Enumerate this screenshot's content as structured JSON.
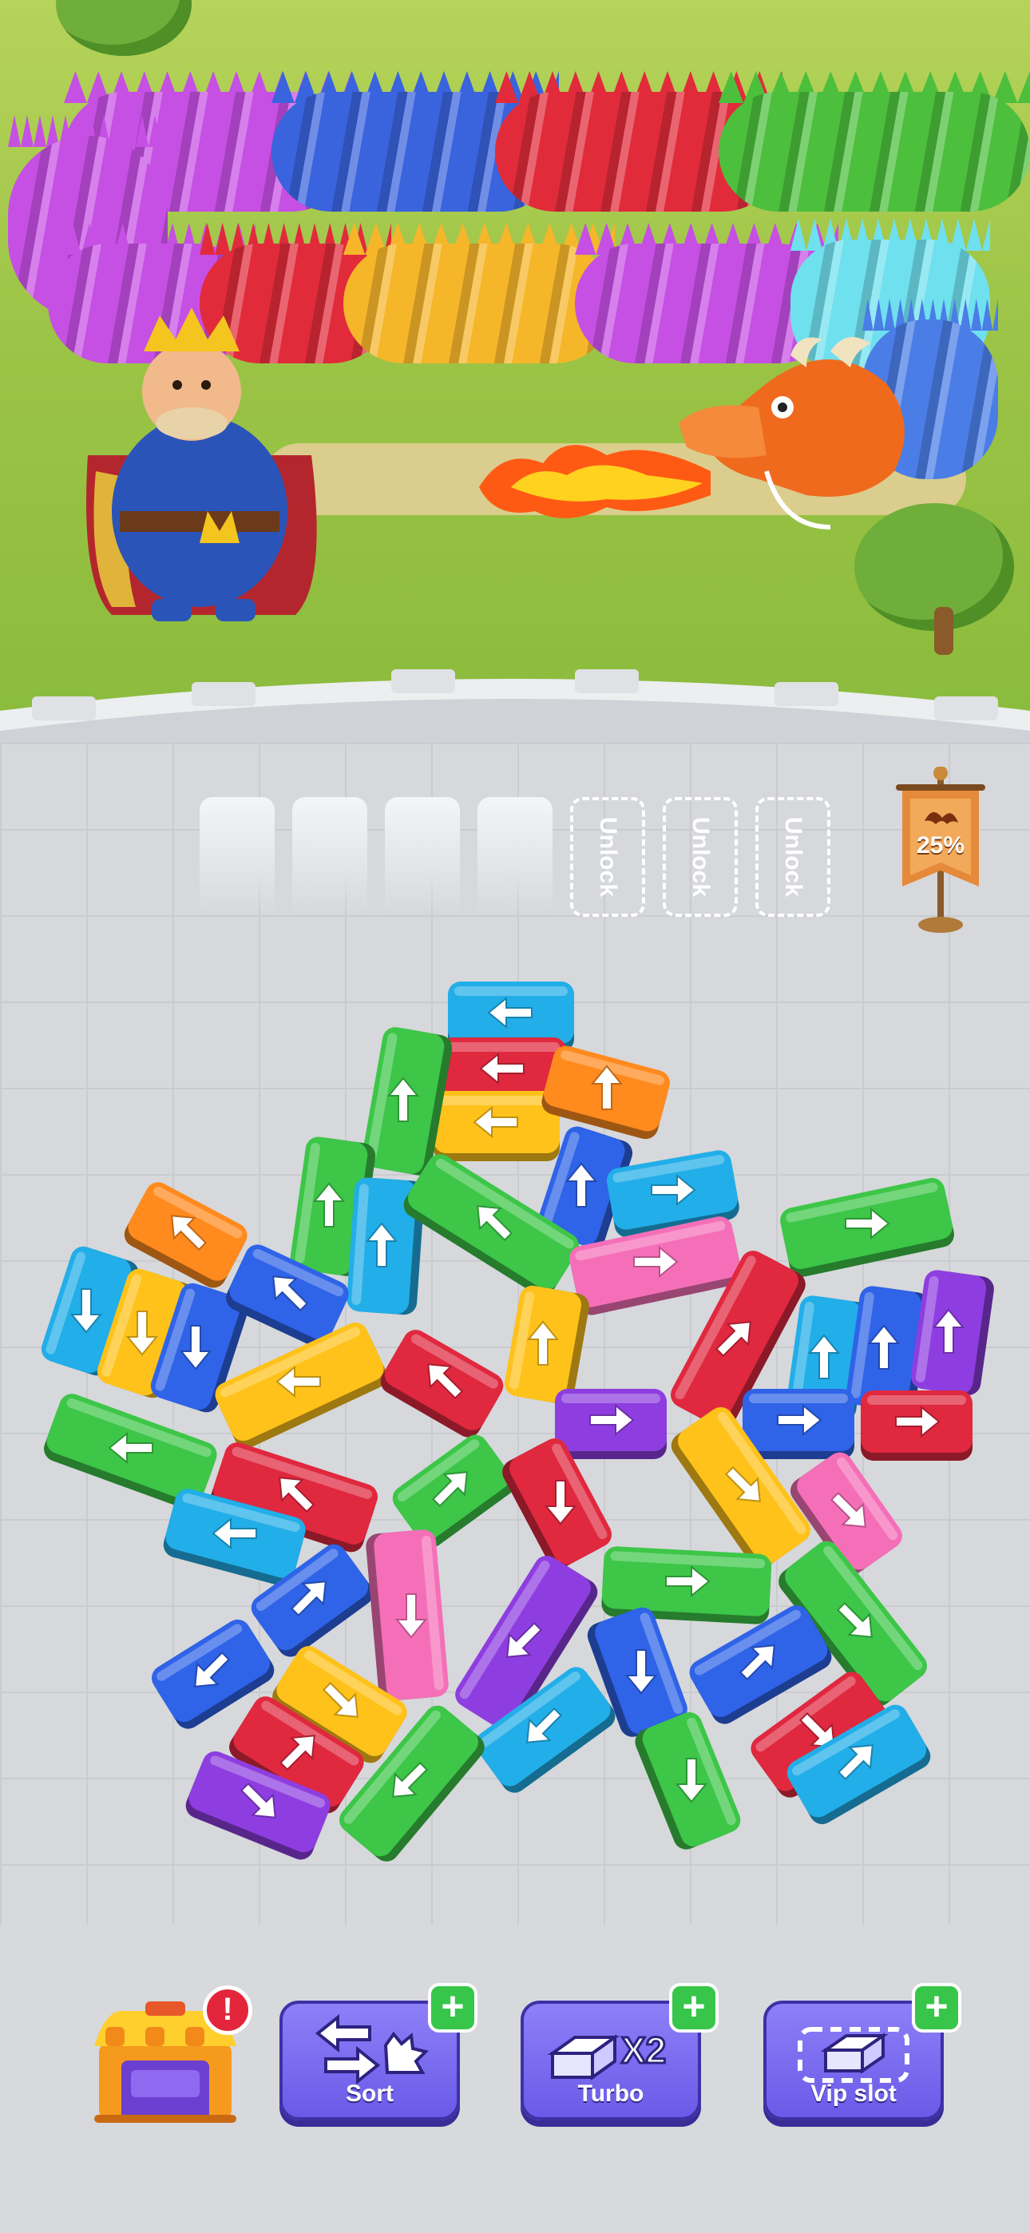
{
  "slots": {
    "open_count": 4,
    "locked": [
      {
        "label": "Unlock"
      },
      {
        "label": "Unlock"
      },
      {
        "label": "Unlock"
      }
    ]
  },
  "progress": {
    "percent_label": "25%",
    "value": 0.25
  },
  "toolbar": {
    "shop": {
      "icon": "shop-icon",
      "badge": "!"
    },
    "buttons": [
      {
        "label": "Sort",
        "icon": "sort-icon",
        "plus": "+"
      },
      {
        "label": "Turbo",
        "icon": "turbo-icon",
        "icon_text": "X2",
        "plus": "+"
      },
      {
        "label": "Vip slot",
        "icon": "vip-slot-icon",
        "plus": "+"
      }
    ]
  },
  "colors": {
    "red": "#e0283f",
    "green": "#3dc648",
    "blue": "#2f63e8",
    "cyan": "#22aee8",
    "yellow": "#ffc21a",
    "orange": "#ff8a1e",
    "pink": "#f56fb8",
    "purple": "#8e3ee0"
  },
  "blocks": [
    {
      "color": "cyan",
      "dir": "left"
    },
    {
      "color": "red",
      "dir": "left"
    },
    {
      "color": "yellow",
      "dir": "left"
    },
    {
      "color": "orange",
      "dir": "up"
    },
    {
      "color": "green",
      "dir": "up"
    },
    {
      "color": "green",
      "dir": "up"
    },
    {
      "color": "cyan",
      "dir": "up"
    },
    {
      "color": "blue",
      "dir": "up"
    },
    {
      "color": "cyan",
      "dir": "right"
    },
    {
      "color": "green",
      "dir": "up-left"
    },
    {
      "color": "green",
      "dir": "right"
    },
    {
      "color": "pink",
      "dir": "right"
    },
    {
      "color": "orange",
      "dir": "up-left"
    },
    {
      "color": "cyan",
      "dir": "down"
    },
    {
      "color": "yellow",
      "dir": "down"
    },
    {
      "color": "blue",
      "dir": "down"
    },
    {
      "color": "blue",
      "dir": "up-left"
    },
    {
      "color": "yellow",
      "dir": "left"
    },
    {
      "color": "yellow",
      "dir": "up"
    },
    {
      "color": "red",
      "dir": "up-left"
    },
    {
      "color": "red",
      "dir": "up-right"
    },
    {
      "color": "cyan",
      "dir": "up"
    },
    {
      "color": "blue",
      "dir": "up"
    },
    {
      "color": "purple",
      "dir": "up"
    },
    {
      "color": "green",
      "dir": "left"
    },
    {
      "color": "purple",
      "dir": "right"
    },
    {
      "color": "blue",
      "dir": "right"
    },
    {
      "color": "red",
      "dir": "right"
    },
    {
      "color": "red",
      "dir": "up-left"
    },
    {
      "color": "green",
      "dir": "up-right"
    },
    {
      "color": "red",
      "dir": "down"
    },
    {
      "color": "yellow",
      "dir": "down-right"
    },
    {
      "color": "cyan",
      "dir": "left"
    },
    {
      "color": "pink",
      "dir": "down-right"
    },
    {
      "color": "blue",
      "dir": "up-right"
    },
    {
      "color": "pink",
      "dir": "down"
    },
    {
      "color": "green",
      "dir": "right"
    },
    {
      "color": "green",
      "dir": "down-right"
    },
    {
      "color": "purple",
      "dir": "down-left"
    },
    {
      "color": "blue",
      "dir": "down-left"
    },
    {
      "color": "blue",
      "dir": "down"
    },
    {
      "color": "blue",
      "dir": "up-right"
    },
    {
      "color": "yellow",
      "dir": "down-right"
    },
    {
      "color": "red",
      "dir": "up-right"
    },
    {
      "color": "cyan",
      "dir": "down-left"
    },
    {
      "color": "red",
      "dir": "down-right"
    },
    {
      "color": "green",
      "dir": "down-left"
    },
    {
      "color": "green",
      "dir": "down"
    },
    {
      "color": "cyan",
      "dir": "up-right"
    },
    {
      "color": "purple",
      "dir": "down-right"
    }
  ]
}
